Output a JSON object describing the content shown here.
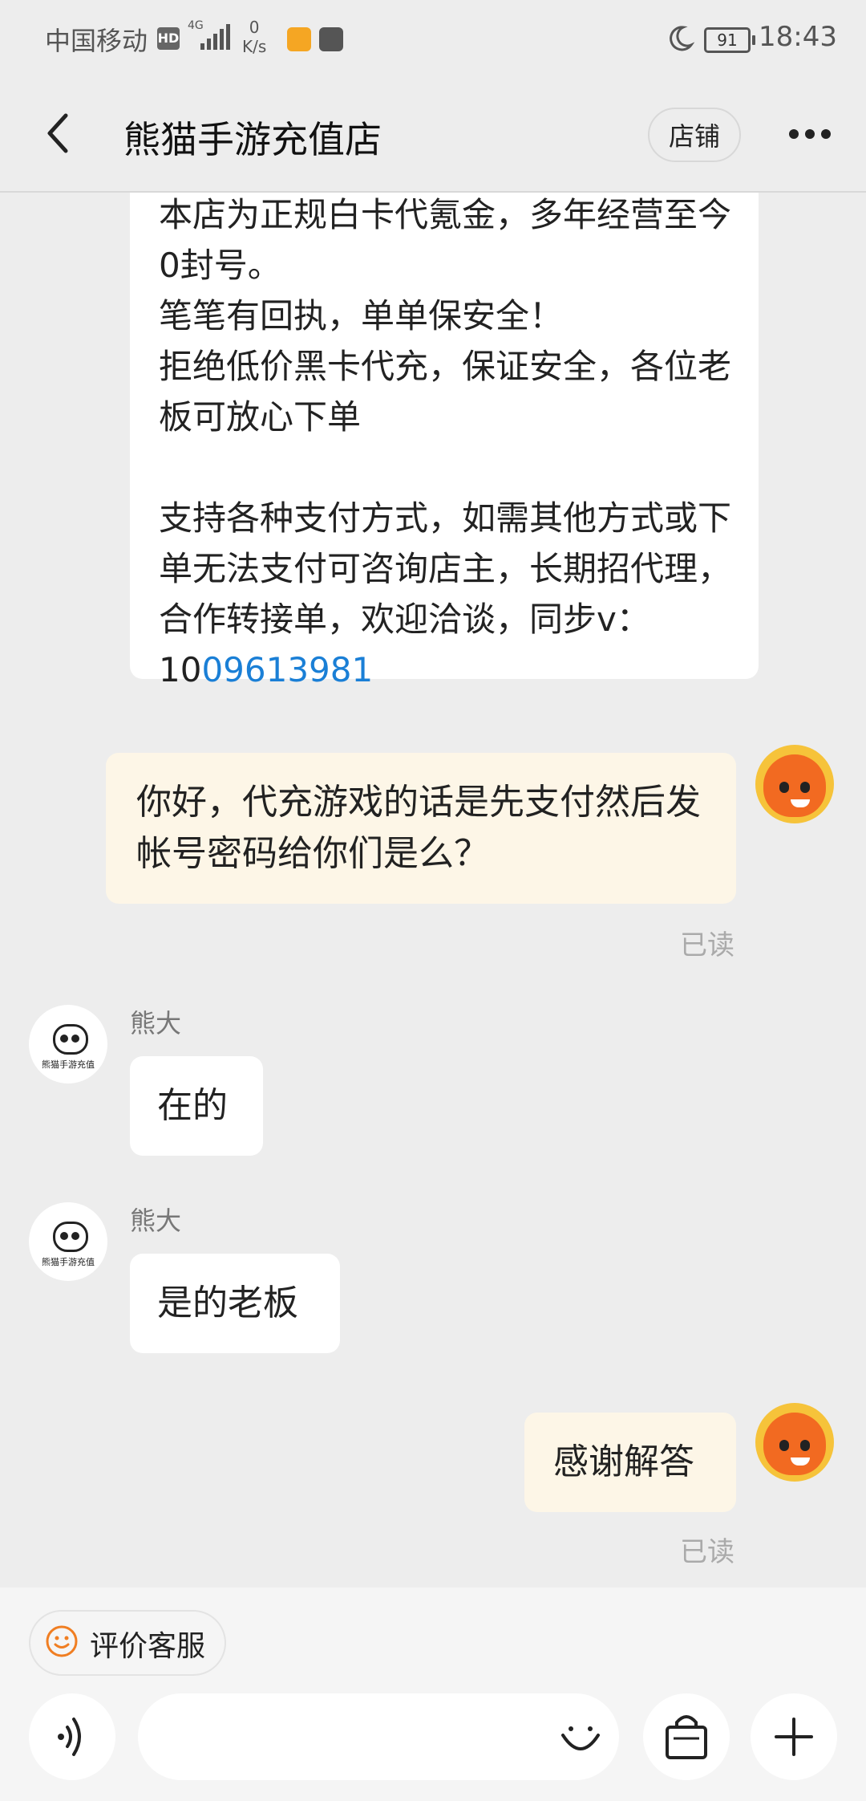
{
  "status_bar": {
    "carrier": "中国移动",
    "hd": "HD",
    "network": "4G",
    "speed_value": "0",
    "speed_unit": "K/s",
    "battery": "91",
    "time": "18:43"
  },
  "header": {
    "title": "熊猫手游充值店",
    "shop_button": "店铺"
  },
  "messages": {
    "card_text": "本店为正规白卡代氪金，多年经营至今0封号。\n笔笔有回执，单单保安全！\n拒绝低价黑卡代充，保证安全，各位老板可放心下单\n\n支持各种支付方式，如需其他方式或下单无法支付可咨询店主，长期招代理，合作转接单，欢迎洽谈，同步v：10",
    "card_link": "09613981",
    "msg1_text": "你好，代充游戏的话是先支付然后发帐号密码给你们是么？",
    "msg1_status": "已读",
    "msg2_sender": "熊大",
    "msg2_text": "在的",
    "msg3_sender": "熊大",
    "msg3_text": "是的老板",
    "msg4_text": "感谢解答",
    "msg4_status": "已读",
    "panda_avatar_caption": "熊猫手游充值"
  },
  "bottom_bar": {
    "rate_button": "评价客服",
    "input_placeholder": ""
  },
  "colors": {
    "background": "#ededed",
    "my_bubble": "#fdf6e7",
    "link": "#1a7fd6",
    "accent_orange": "#f07e22"
  }
}
